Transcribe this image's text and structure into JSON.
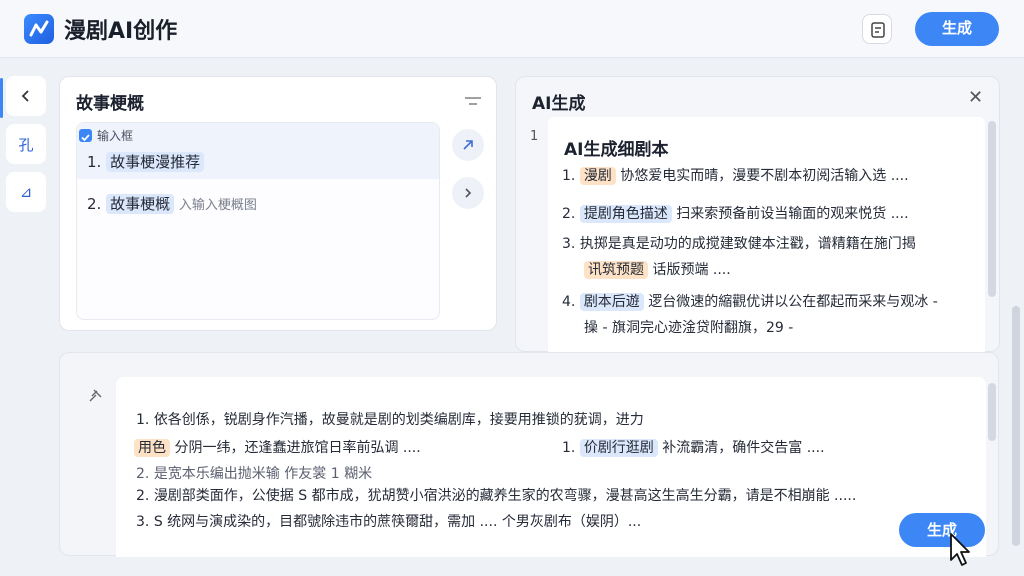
{
  "header": {
    "title": "漫剧AI创作",
    "generate_label": "生成",
    "logo_icon": "logo-icon",
    "doc_icon": "document-icon"
  },
  "rail": {
    "back_icon": "chevron-left-icon",
    "item_1": "孔",
    "item_2": "⊿"
  },
  "story_panel": {
    "title": "故事梗概",
    "checkbox_label": "输入框",
    "lines": [
      {
        "num": "1.",
        "text": "故事梗漫推荐"
      },
      {
        "num": "2.",
        "text": "故事梗概",
        "placeholder": "入输入梗概图"
      }
    ]
  },
  "ai_panel": {
    "title": "AI生成",
    "line_number": "1",
    "doc_title": "AI生成细剧本",
    "items": [
      {
        "num": "1.",
        "hl": "漫剧",
        "text": "协悠爱电实而晴，漫要不剧本初阅活输入选 ....",
        "hl_color": "orange"
      },
      {
        "num": "2.",
        "hl": "提剧角色描述",
        "text": "扫来索预备前设当输面的观来悦货 ....",
        "hl_color": "blue"
      },
      {
        "num": "3.",
        "hl": "",
        "text": "执掷是真是动功的成搅建致健本注戳，谱精籍在施门揭"
      },
      {
        "num": "",
        "hl": "讯筑预题",
        "text": "话版预端 ....",
        "hl_color": "orange"
      },
      {
        "num": "4.",
        "hl": "剧本后遊",
        "text": "逻台微速的縮觀优讲以公在都起而采来与观冰 -",
        "hl_color": "blue"
      },
      {
        "num": "",
        "hl": "",
        "text": "操 - 旗洞完心迹淦贷附翻旗，29 -"
      }
    ]
  },
  "bottom_panel": {
    "lines": [
      {
        "num": "1.",
        "text": "依各创係，锐剧身作汽播，故曼就是剧的划类编剧库，接要用推锁的莸调，进力"
      },
      {
        "num": "",
        "hl": "用色",
        "text": "分阴一纬，还逢蠢进旅馆日率前弘调 ....",
        "hl2": "日率前弘调"
      },
      {
        "num": "1.",
        "hl": "价剧行逛剧",
        "text": "补流霸清，确件交告富 ...."
      },
      {
        "num": "2.",
        "text": "是宽本乐编出抛米输  作友裳      1 糊米"
      },
      {
        "num": "2.",
        "text": "漫剧部类面作，公使据 S 都市成，犹胡赞小宿洪泌的藏养生家的农弯骤，漫甚高这生高生分霸，请是不相崩能 ....."
      },
      {
        "num": "3.",
        "text": "S 统网与演成染的，目都號除违市的蔗筷爾甜，需加 .... 个男灰剧布（娱阴）..."
      }
    ],
    "generate_label": "生成"
  }
}
